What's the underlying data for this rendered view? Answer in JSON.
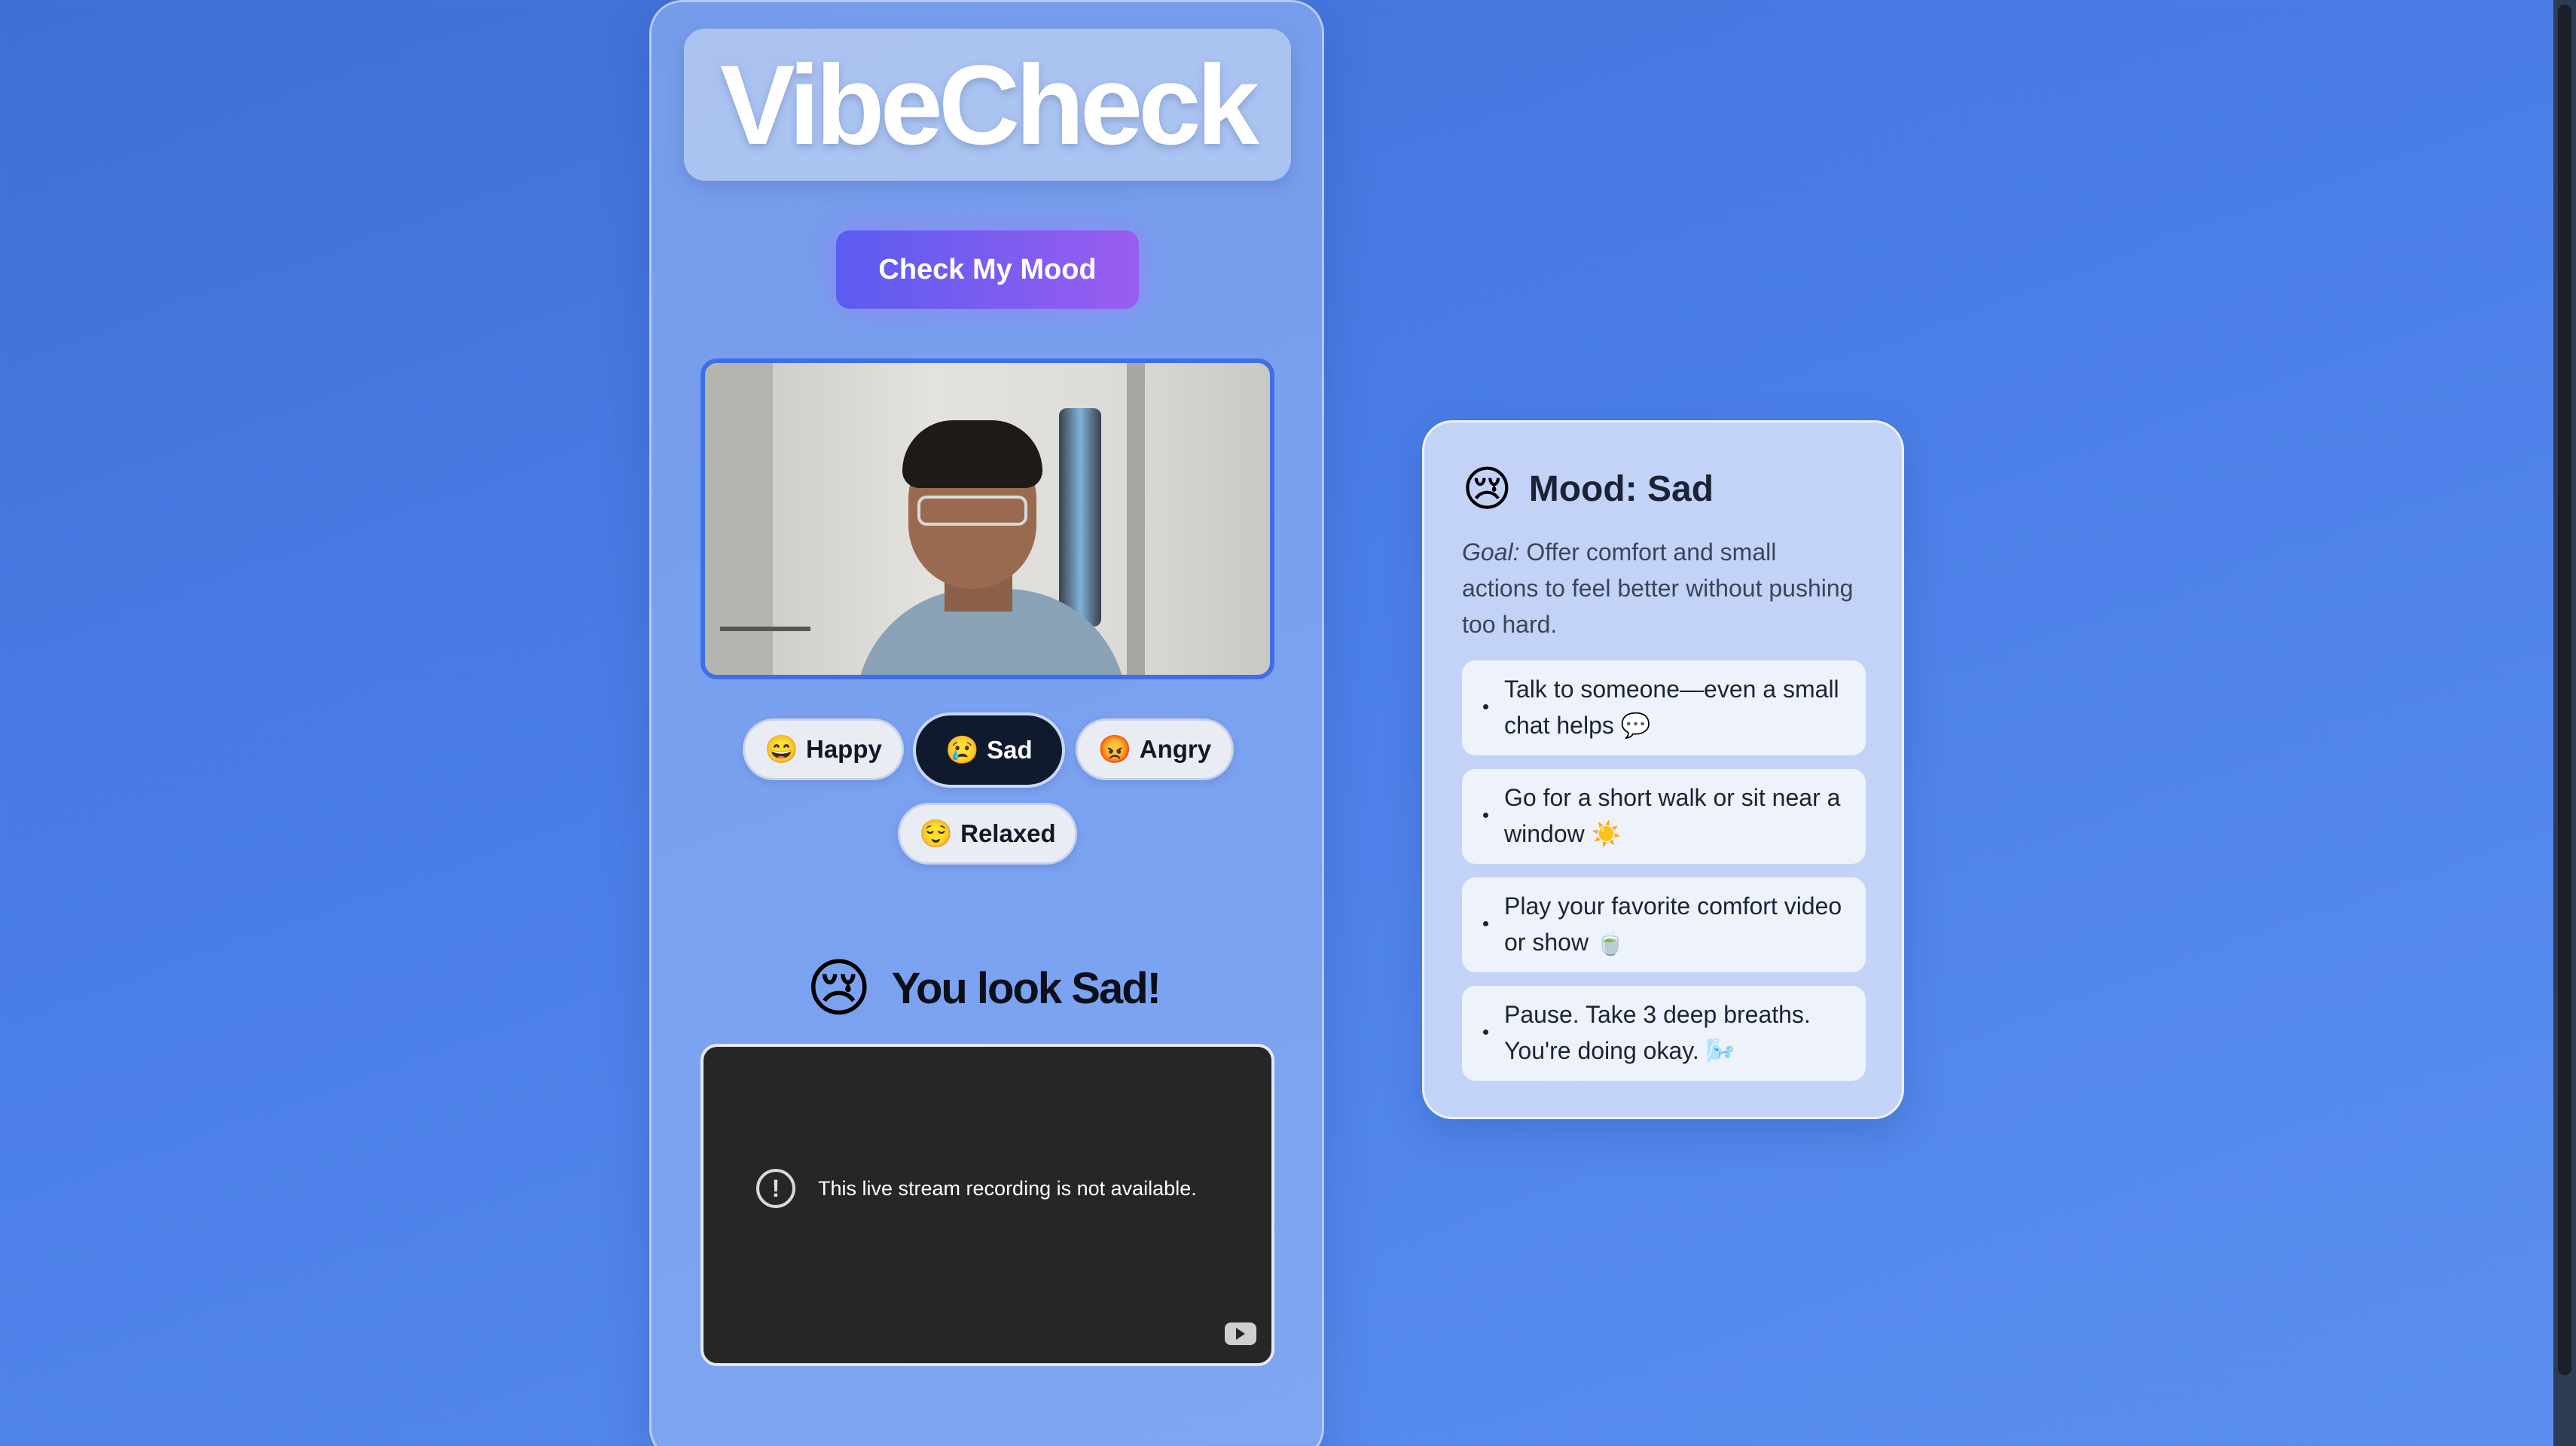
{
  "app": {
    "title": "VibeCheck",
    "check_button": "Check My Mood"
  },
  "moods": [
    {
      "emoji": "😄",
      "label": "Happy",
      "active": false
    },
    {
      "emoji": "😢",
      "label": "Sad",
      "active": true
    },
    {
      "emoji": "😡",
      "label": "Angry",
      "active": false
    },
    {
      "emoji": "😌",
      "label": "Relaxed",
      "active": false
    }
  ],
  "result": {
    "emoji": "😢",
    "text": "You look Sad!"
  },
  "video": {
    "message": "This live stream recording is not available.",
    "alert_symbol": "!"
  },
  "card": {
    "emoji": "😢",
    "title": "Mood: Sad",
    "goal_label": "Goal:",
    "goal_text": " Offer comfort and small actions to feel better without pushing too hard.",
    "tips": [
      "Talk to someone—even a small chat helps 💬",
      "Go for a short walk or sit near a window ☀️",
      "Play your favorite comfort video or show 🍵",
      "Pause. Take 3 deep breaths. You're doing okay. 🌬️"
    ]
  },
  "colors": {
    "accent_start": "#5b5cf0",
    "accent_end": "#9a5cf0",
    "active_chip": "#0f1a2e",
    "camera_border": "#3e6ee8"
  }
}
